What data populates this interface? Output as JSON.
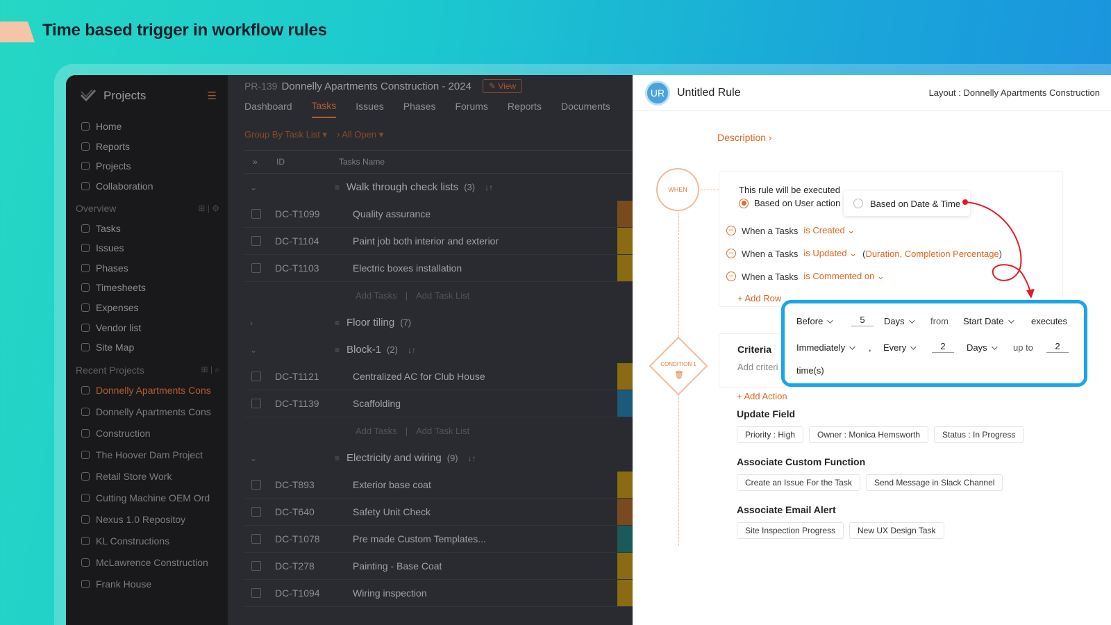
{
  "hero": {
    "title": "Time based trigger in workflow rules"
  },
  "sidebar": {
    "title": "Projects",
    "nav": [
      {
        "label": "Home",
        "icon": "home-icon"
      },
      {
        "label": "Reports",
        "icon": "reports-icon"
      },
      {
        "label": "Projects",
        "icon": "projects-icon"
      },
      {
        "label": "Collaboration",
        "icon": "collaboration-icon"
      }
    ],
    "overview_label": "Overview",
    "overview": [
      {
        "label": "Tasks",
        "icon": "tasks-icon"
      },
      {
        "label": "Issues",
        "icon": "issues-icon"
      },
      {
        "label": "Phases",
        "icon": "phases-icon"
      },
      {
        "label": "Timesheets",
        "icon": "timesheets-icon"
      },
      {
        "label": "Expenses",
        "icon": "expenses-icon"
      },
      {
        "label": "Vendor list",
        "icon": "vendor-icon"
      },
      {
        "label": "Site Map",
        "icon": "sitemap-icon"
      }
    ],
    "recent_label": "Recent Projects",
    "recent": [
      "Donnelly Apartments Cons",
      "Donnelly Apartments Cons",
      "Construction",
      "The Hoover Dam Project",
      "Retail Store Work",
      "Cutting Machine OEM Ord",
      "Nexus 1.0 Repositoy",
      "KL Constructions",
      "McLawrence Construction",
      "Frank House"
    ]
  },
  "project": {
    "id": "PR-139",
    "name": "Donnelly Apartments Construction - 2024",
    "view_label": "View",
    "tabs": [
      "Dashboard",
      "Tasks",
      "Issues",
      "Phases",
      "Forums",
      "Reports",
      "Documents"
    ],
    "active_tab": "Tasks",
    "filter_group": "Group By Task List",
    "filter_status": "All Open",
    "col_id": "ID",
    "col_name": "Tasks Name",
    "add_tasks": "Add Tasks",
    "add_task_list": "Add Task List",
    "groups": [
      {
        "name": "Walk through check lists",
        "count": "(3)",
        "tasks": [
          {
            "id": "DC-T1099",
            "name": "Quality assurance",
            "color": "#7a4a1f"
          },
          {
            "id": "DC-T1104",
            "name": "Paint job both interior and exterior",
            "color": "#8a6a12"
          },
          {
            "id": "DC-T1103",
            "name": "Electric boxes installation",
            "color": "#8a6a12"
          }
        ]
      },
      {
        "name": "Floor tiling",
        "count": "(7)",
        "tasks": []
      },
      {
        "name": "Block-1",
        "count": "(2)",
        "tasks": [
          {
            "id": "DC-T1121",
            "name": "Centralized AC for Club House",
            "color": "#8a6a12"
          },
          {
            "id": "DC-T1139",
            "name": "Scaffolding",
            "color": "#1b5a7a"
          }
        ]
      },
      {
        "name": "Electricity and wiring",
        "count": "(9)",
        "tasks": [
          {
            "id": "DC-T893",
            "name": "Exterior base coat",
            "color": "#8a6a12"
          },
          {
            "id": "DC-T640",
            "name": "Safety Unit Check",
            "color": "#7a4a1f"
          },
          {
            "id": "DC-T1078",
            "name": "Pre made Custom Templates...",
            "color": "#1b5a5a"
          },
          {
            "id": "DC-T278",
            "name": "Painting - Base Coat",
            "color": "#8a6a12"
          },
          {
            "id": "DC-T1094",
            "name": "Wiring inspection",
            "color": "#8a6a12"
          }
        ]
      }
    ]
  },
  "rule": {
    "avatar": "UR",
    "title": "Untitled Rule",
    "layout_label": "Layout :",
    "layout_value": "Donnelly Apartments Construction",
    "description_label": "Description",
    "when_label": "WHEN",
    "executed_text": "This rule will be executed",
    "option_user": "Based on User action",
    "option_date": "Based on Date & Time",
    "conditions": [
      {
        "prefix": "When a Tasks",
        "action": "is Created",
        "extra": ""
      },
      {
        "prefix": "When a Tasks",
        "action": "is Updated",
        "extra": "Duration, Completion Percentage"
      },
      {
        "prefix": "When a Tasks",
        "action": "is Commented on",
        "extra": ""
      }
    ],
    "add_row": "+ Add Row",
    "condition_label": "CONDITION 1",
    "criteria_title": "Criteria",
    "criteria_add": "Add criteri",
    "add_action": "+ Add Action",
    "update_field_title": "Update Field",
    "update_fields": [
      {
        "key": "Priority :",
        "value": "High"
      },
      {
        "key": "Owner :",
        "value": "Monica Hemsworth"
      },
      {
        "key": "Status :",
        "value": "In Progress"
      }
    ],
    "custom_function_title": "Associate Custom Function",
    "custom_functions": [
      "Create an Issue For the Task",
      "Send Message in Slack Channel"
    ],
    "email_alert_title": "Associate Email Alert",
    "email_alerts": [
      "Site Inspection Progress",
      "New UX Design Task"
    ]
  },
  "trigger": {
    "timing": "Before",
    "offset": "5",
    "offset_unit": "Days",
    "from_label": "from",
    "date_field": "Start Date",
    "executes_label": "executes",
    "frequency_start": "Immediately",
    "comma": ",",
    "repeat": "Every",
    "repeat_value": "2",
    "repeat_unit": "Days",
    "upto_label": "up to",
    "upto_value": "2",
    "times_label": "time(s)"
  },
  "colors": {
    "accent": "#e0651c",
    "highlight": "#1aa6e8",
    "avatar": "#4aa3db"
  }
}
